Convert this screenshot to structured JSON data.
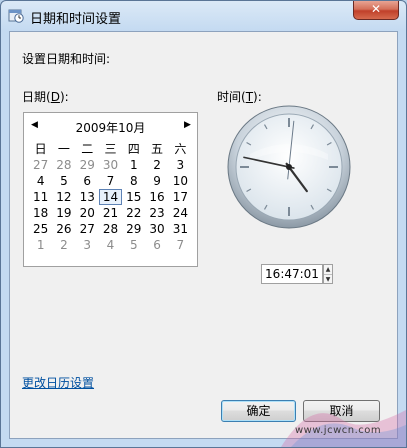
{
  "window": {
    "title": "日期和时间设置",
    "close_label": "✕"
  },
  "main": {
    "heading": "设置日期和时间:",
    "date_label_prefix": "日期(",
    "date_label_key": "D",
    "date_label_suffix": "):",
    "time_label_prefix": "时间(",
    "time_label_key": "T",
    "time_label_suffix": "):"
  },
  "calendar": {
    "month_title": "2009年10月",
    "prev_arrow": "◀",
    "next_arrow": "▶",
    "weekdays": [
      "日",
      "一",
      "二",
      "三",
      "四",
      "五",
      "六"
    ],
    "weeks": [
      [
        "27",
        "28",
        "29",
        "30",
        "1",
        "2",
        "3"
      ],
      [
        "4",
        "5",
        "6",
        "7",
        "8",
        "9",
        "10"
      ],
      [
        "11",
        "12",
        "13",
        "14",
        "15",
        "16",
        "17"
      ],
      [
        "18",
        "19",
        "20",
        "21",
        "22",
        "23",
        "24"
      ],
      [
        "25",
        "26",
        "27",
        "28",
        "29",
        "30",
        "31"
      ],
      [
        "1",
        "2",
        "3",
        "4",
        "5",
        "6",
        "7"
      ]
    ],
    "selected_day": "14"
  },
  "clock": {
    "hour": 16,
    "minute": 47,
    "second": 1
  },
  "time_field": {
    "value": "16:47:01",
    "spin_up": "▲",
    "spin_down": "▼"
  },
  "footer": {
    "change_calendar_link": "更改日历设置",
    "ok_label": "确定",
    "cancel_label": "取消"
  },
  "watermark": {
    "text": "www.jcwcn.com"
  },
  "colors": {
    "link": "#0050a0",
    "close_button": "#c0402a",
    "selected_day_border": "#5d82b5"
  }
}
